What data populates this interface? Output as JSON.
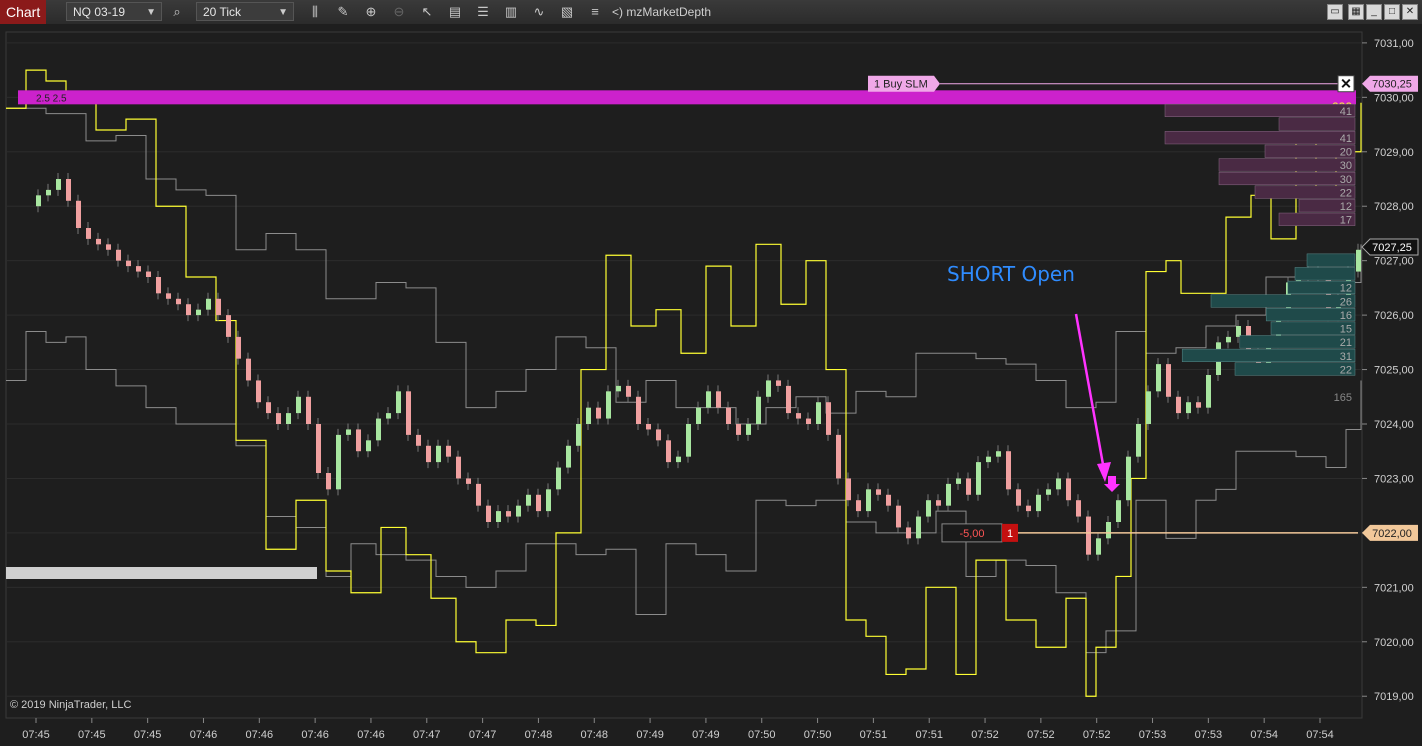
{
  "toolbar": {
    "tab_label": "Chart",
    "instrument": "NQ 03-19",
    "interval": "20 Tick",
    "indicator_label": "<)  mzMarketDepth",
    "icons": [
      "search-icon",
      "bar-chart-icon",
      "pencil-icon",
      "zoom-in-icon",
      "zoom-out-icon",
      "pointer-icon",
      "data-box-icon",
      "properties-icon",
      "indicators-icon",
      "strategies-icon",
      "templates-icon",
      "list-icon"
    ]
  },
  "annotation": "SHORT Open",
  "copyright": "© 2019 NinjaTrader, LLC",
  "colors": {
    "background": "#1e1e1e",
    "yellow_line": "#ffff33",
    "gray_line": "#8c8c8c",
    "up_bar": "#a8e6a0",
    "down_bar": "#f0a0a0",
    "magenta": "#cc22cc",
    "order_line": "#f2c89a",
    "depth_ask": "#4a2a44",
    "depth_bid": "#1f4a4a",
    "annotation": "#2f8cff"
  },
  "chart_data": {
    "type": "line",
    "y_tick_labels": [
      "7031,00",
      "7030,00",
      "7029,00",
      "7028,00",
      "7027,00",
      "7026,00",
      "7025,00",
      "7024,00",
      "7023,00",
      "7022,00",
      "7021,00",
      "7020,00",
      "7019,00"
    ],
    "y_ticks": [
      7031,
      7030,
      7029,
      7028,
      7027,
      7026,
      7025,
      7024,
      7023,
      7022,
      7021,
      7020,
      7019
    ],
    "ylim": [
      7018.6,
      7031.2
    ],
    "x_tick_labels": [
      "07:45",
      "07:45",
      "07:45",
      "07:46",
      "07:46",
      "07:46",
      "07:46",
      "07:47",
      "07:47",
      "07:48",
      "07:48",
      "07:49",
      "07:49",
      "07:50",
      "07:50",
      "07:51",
      "07:51",
      "07:52",
      "07:52",
      "07:52",
      "07:53",
      "07:53",
      "07:54",
      "07:54"
    ],
    "price_markers": [
      {
        "label": "7030,25",
        "value": 7030.25,
        "color": "#f0a8e8"
      },
      {
        "label": "7027,25",
        "value": 7027.25,
        "color": "#111111"
      },
      {
        "label": "7022,00",
        "value": 7022.0,
        "color": "#f2c89a"
      }
    ],
    "buy_order": {
      "label": "1  Buy SLM",
      "price": 7030.25
    },
    "position": {
      "pnl": "-5,00",
      "qty": "1",
      "price": 7022.0
    },
    "highlight_band": {
      "label": "2.5  2.5",
      "price": 7030.0
    },
    "volume_profile_label": "232",
    "ask_depth": [
      {
        "price": 7029.75,
        "size": "41",
        "bar": 0.95
      },
      {
        "price": 7029.5,
        "size": "",
        "bar": 0.38
      },
      {
        "price": 7029.25,
        "size": "41",
        "bar": 0.95
      },
      {
        "price": 7029.0,
        "size": "20",
        "bar": 0.45
      },
      {
        "price": 7028.75,
        "size": "30",
        "bar": 0.68
      },
      {
        "price": 7028.5,
        "size": "30",
        "bar": 0.68
      },
      {
        "price": 7028.25,
        "size": "22",
        "bar": 0.5
      },
      {
        "price": 7028.0,
        "size": "12",
        "bar": 0.28
      },
      {
        "price": 7027.75,
        "size": "17",
        "bar": 0.38
      }
    ],
    "bid_depth": [
      {
        "price": 7027.0,
        "size": "",
        "bar": 0.2
      },
      {
        "price": 7026.75,
        "size": "",
        "bar": 0.25
      },
      {
        "price": 7026.5,
        "size": "12",
        "bar": 0.28
      },
      {
        "price": 7026.25,
        "size": "26",
        "bar": 0.6
      },
      {
        "price": 7026.0,
        "size": "16",
        "bar": 0.37
      },
      {
        "price": 7025.75,
        "size": "15",
        "bar": 0.35
      },
      {
        "price": 7025.5,
        "size": "21",
        "bar": 0.48
      },
      {
        "price": 7025.25,
        "size": "31",
        "bar": 0.72
      },
      {
        "price": 7025.0,
        "size": "22",
        "bar": 0.5
      }
    ],
    "depth_bottom_label": "165",
    "yellow_line": [
      [
        0,
        7029.8
      ],
      [
        20,
        7030.5
      ],
      [
        40,
        7030.3
      ],
      [
        60,
        7030.0
      ],
      [
        90,
        7029.4
      ],
      [
        120,
        7029.6
      ],
      [
        150,
        7028.0
      ],
      [
        180,
        7026.7
      ],
      [
        210,
        7025.9
      ],
      [
        230,
        7023.7
      ],
      [
        260,
        7021.7
      ],
      [
        290,
        7022.6
      ],
      [
        320,
        7021.3
      ],
      [
        345,
        7020.9
      ],
      [
        375,
        7022.1
      ],
      [
        400,
        7021.6
      ],
      [
        425,
        7020.8
      ],
      [
        450,
        7020.0
      ],
      [
        470,
        7019.8
      ],
      [
        500,
        7020.4
      ],
      [
        530,
        7020.3
      ],
      [
        550,
        7022.0
      ],
      [
        575,
        7025.0
      ],
      [
        600,
        7027.1
      ],
      [
        625,
        7025.8
      ],
      [
        650,
        7026.1
      ],
      [
        675,
        7025.3
      ],
      [
        700,
        7026.9
      ],
      [
        725,
        7025.8
      ],
      [
        750,
        7027.3
      ],
      [
        775,
        7026.2
      ],
      [
        800,
        7027.0
      ],
      [
        820,
        7025.0
      ],
      [
        840,
        7020.4
      ],
      [
        860,
        7020.1
      ],
      [
        880,
        7019.4
      ],
      [
        900,
        7019.5
      ],
      [
        920,
        7021.0
      ],
      [
        950,
        7019.4
      ],
      [
        970,
        7021.5
      ],
      [
        1000,
        7020.4
      ],
      [
        1030,
        7019.9
      ],
      [
        1060,
        7020.8
      ],
      [
        1080,
        7019.0
      ],
      [
        1090,
        7019.9
      ],
      [
        1110,
        7021.2
      ],
      [
        1125,
        7023.0
      ],
      [
        1140,
        7026.8
      ],
      [
        1160,
        7027.0
      ],
      [
        1175,
        7026.4
      ],
      [
        1200,
        7026.4
      ],
      [
        1220,
        7027.8
      ],
      [
        1245,
        7028.2
      ],
      [
        1265,
        7027.4
      ],
      [
        1290,
        7029.2
      ],
      [
        1310,
        7028.3
      ],
      [
        1330,
        7029.0
      ],
      [
        1355,
        7029.9
      ]
    ],
    "gray_line": [
      [
        0,
        7024.8
      ],
      [
        20,
        7025.7
      ],
      [
        40,
        7025.5
      ],
      [
        60,
        7025.6
      ],
      [
        80,
        7025.0
      ],
      [
        110,
        7024.7
      ],
      [
        140,
        7024.3
      ],
      [
        170,
        7024.0
      ],
      [
        200,
        7024.0
      ],
      [
        230,
        7023.6
      ],
      [
        260,
        7022.3
      ],
      [
        290,
        7022.1
      ],
      [
        320,
        7021.2
      ],
      [
        345,
        7021.8
      ],
      [
        370,
        7021.6
      ],
      [
        400,
        7021.5
      ],
      [
        430,
        7021.2
      ],
      [
        460,
        7021.0
      ],
      [
        490,
        7021.3
      ],
      [
        520,
        7021.8
      ],
      [
        550,
        7021.8
      ],
      [
        570,
        7021.6
      ],
      [
        600,
        7021.7
      ],
      [
        630,
        7020.5
      ],
      [
        660,
        7021.8
      ],
      [
        690,
        7021.6
      ],
      [
        720,
        7021.3
      ],
      [
        750,
        7022.6
      ],
      [
        780,
        7022.5
      ],
      [
        810,
        7022.6
      ],
      [
        840,
        7022.2
      ],
      [
        870,
        7022.0
      ],
      [
        900,
        7022.0
      ],
      [
        930,
        7022.4
      ],
      [
        960,
        7021.2
      ],
      [
        990,
        7021.5
      ],
      [
        1020,
        7021.4
      ],
      [
        1050,
        7020.9
      ],
      [
        1080,
        7019.8
      ],
      [
        1100,
        7020.2
      ],
      [
        1130,
        7022.6
      ],
      [
        1160,
        7021.9
      ],
      [
        1190,
        7022.6
      ],
      [
        1210,
        7022.8
      ],
      [
        1230,
        7023.5
      ],
      [
        1260,
        7023.5
      ],
      [
        1290,
        7023.4
      ],
      [
        1320,
        7023.2
      ],
      [
        1340,
        7023.9
      ],
      [
        1355,
        7024.8
      ]
    ],
    "gray_line2": [
      [
        0,
        7029.8
      ],
      [
        40,
        7029.7
      ],
      [
        80,
        7029.2
      ],
      [
        110,
        7029.3
      ],
      [
        140,
        7028.5
      ],
      [
        170,
        7028.3
      ],
      [
        200,
        7028.2
      ],
      [
        230,
        7027.2
      ],
      [
        260,
        7027.5
      ],
      [
        290,
        7027.2
      ],
      [
        320,
        7026.3
      ],
      [
        345,
        7026.3
      ],
      [
        370,
        7026.6
      ],
      [
        400,
        7026.5
      ],
      [
        430,
        7025.5
      ],
      [
        460,
        7024.3
      ],
      [
        490,
        7024.6
      ],
      [
        520,
        7025.0
      ],
      [
        550,
        7025.6
      ],
      [
        580,
        7025.4
      ],
      [
        610,
        7024.4
      ],
      [
        640,
        7024.8
      ],
      [
        670,
        7024.3
      ],
      [
        700,
        7024.3
      ],
      [
        730,
        7024.0
      ],
      [
        760,
        7024.3
      ],
      [
        790,
        7024.5
      ],
      [
        820,
        7024.2
      ],
      [
        850,
        7024.6
      ],
      [
        880,
        7024.5
      ],
      [
        910,
        7025.3
      ],
      [
        940,
        7025.3
      ],
      [
        970,
        7025.2
      ],
      [
        1000,
        7025.1
      ],
      [
        1030,
        7024.8
      ],
      [
        1060,
        7024.3
      ],
      [
        1090,
        7024.4
      ],
      [
        1110,
        7025.7
      ],
      [
        1140,
        7025.3
      ],
      [
        1170,
        7025.4
      ],
      [
        1200,
        7025.8
      ],
      [
        1230,
        7026.0
      ],
      [
        1260,
        7026.7
      ],
      [
        1290,
        7026.7
      ],
      [
        1320,
        7026.6
      ],
      [
        1355,
        7027.3
      ]
    ],
    "bars_close": [
      [
        20,
        7028.0
      ],
      [
        30,
        7028.2
      ],
      [
        40,
        7028.3
      ],
      [
        50,
        7028.5
      ],
      [
        60,
        7028.1
      ],
      [
        70,
        7027.6
      ],
      [
        80,
        7027.4
      ],
      [
        90,
        7027.3
      ],
      [
        100,
        7027.2
      ],
      [
        110,
        7027.0
      ],
      [
        120,
        7026.9
      ],
      [
        130,
        7026.8
      ],
      [
        140,
        7026.7
      ],
      [
        150,
        7026.4
      ],
      [
        160,
        7026.3
      ],
      [
        170,
        7026.2
      ],
      [
        180,
        7026.0
      ],
      [
        190,
        7026.1
      ],
      [
        200,
        7026.3
      ],
      [
        210,
        7026.0
      ],
      [
        220,
        7025.6
      ],
      [
        230,
        7025.2
      ],
      [
        240,
        7024.8
      ],
      [
        250,
        7024.4
      ],
      [
        260,
        7024.2
      ],
      [
        270,
        7024.0
      ],
      [
        280,
        7024.2
      ],
      [
        290,
        7024.5
      ],
      [
        300,
        7024.0
      ],
      [
        310,
        7023.1
      ],
      [
        320,
        7022.8
      ],
      [
        330,
        7023.8
      ],
      [
        340,
        7023.9
      ],
      [
        350,
        7023.5
      ],
      [
        360,
        7023.7
      ],
      [
        370,
        7024.1
      ],
      [
        380,
        7024.2
      ],
      [
        390,
        7024.6
      ],
      [
        400,
        7023.8
      ],
      [
        410,
        7023.6
      ],
      [
        420,
        7023.3
      ],
      [
        430,
        7023.6
      ],
      [
        440,
        7023.4
      ],
      [
        450,
        7023.0
      ],
      [
        460,
        7022.9
      ],
      [
        470,
        7022.5
      ],
      [
        480,
        7022.2
      ],
      [
        490,
        7022.4
      ],
      [
        500,
        7022.3
      ],
      [
        510,
        7022.5
      ],
      [
        520,
        7022.7
      ],
      [
        530,
        7022.4
      ],
      [
        540,
        7022.8
      ],
      [
        550,
        7023.2
      ],
      [
        560,
        7023.6
      ],
      [
        570,
        7024.0
      ],
      [
        580,
        7024.3
      ],
      [
        590,
        7024.1
      ],
      [
        600,
        7024.6
      ],
      [
        610,
        7024.7
      ],
      [
        620,
        7024.5
      ],
      [
        630,
        7024.0
      ],
      [
        640,
        7023.9
      ],
      [
        650,
        7023.7
      ],
      [
        660,
        7023.3
      ],
      [
        670,
        7023.4
      ],
      [
        680,
        7024.0
      ],
      [
        690,
        7024.3
      ],
      [
        700,
        7024.6
      ],
      [
        710,
        7024.3
      ],
      [
        720,
        7024.0
      ],
      [
        730,
        7023.8
      ],
      [
        740,
        7024.0
      ],
      [
        750,
        7024.5
      ],
      [
        760,
        7024.8
      ],
      [
        770,
        7024.7
      ],
      [
        780,
        7024.2
      ],
      [
        790,
        7024.1
      ],
      [
        800,
        7024.0
      ],
      [
        810,
        7024.4
      ],
      [
        820,
        7023.8
      ],
      [
        830,
        7023.0
      ],
      [
        840,
        7022.6
      ],
      [
        850,
        7022.4
      ],
      [
        860,
        7022.8
      ],
      [
        870,
        7022.7
      ],
      [
        880,
        7022.5
      ],
      [
        890,
        7022.1
      ],
      [
        900,
        7021.9
      ],
      [
        910,
        7022.3
      ],
      [
        920,
        7022.6
      ],
      [
        930,
        7022.5
      ],
      [
        940,
        7022.9
      ],
      [
        950,
        7023.0
      ],
      [
        960,
        7022.7
      ],
      [
        970,
        7023.3
      ],
      [
        980,
        7023.4
      ],
      [
        990,
        7023.5
      ],
      [
        1000,
        7022.8
      ],
      [
        1010,
        7022.5
      ],
      [
        1020,
        7022.4
      ],
      [
        1030,
        7022.7
      ],
      [
        1040,
        7022.8
      ],
      [
        1050,
        7023.0
      ],
      [
        1060,
        7022.6
      ],
      [
        1070,
        7022.3
      ],
      [
        1080,
        7021.6
      ],
      [
        1090,
        7021.9
      ],
      [
        1100,
        7022.2
      ],
      [
        1110,
        7022.6
      ],
      [
        1120,
        7023.4
      ],
      [
        1130,
        7024.0
      ],
      [
        1140,
        7024.6
      ],
      [
        1150,
        7025.1
      ],
      [
        1160,
        7024.5
      ],
      [
        1170,
        7024.2
      ],
      [
        1180,
        7024.4
      ],
      [
        1190,
        7024.3
      ],
      [
        1200,
        7024.9
      ],
      [
        1210,
        7025.5
      ],
      [
        1220,
        7025.6
      ],
      [
        1230,
        7025.8
      ],
      [
        1240,
        7025.3
      ],
      [
        1250,
        7025.1
      ],
      [
        1260,
        7025.5
      ],
      [
        1270,
        7026.0
      ],
      [
        1280,
        7026.6
      ],
      [
        1290,
        7026.7
      ],
      [
        1300,
        7026.8
      ],
      [
        1310,
        7026.7
      ],
      [
        1320,
        7026.0
      ],
      [
        1330,
        7026.3
      ],
      [
        1340,
        7026.8
      ],
      [
        1350,
        7027.2
      ]
    ]
  }
}
